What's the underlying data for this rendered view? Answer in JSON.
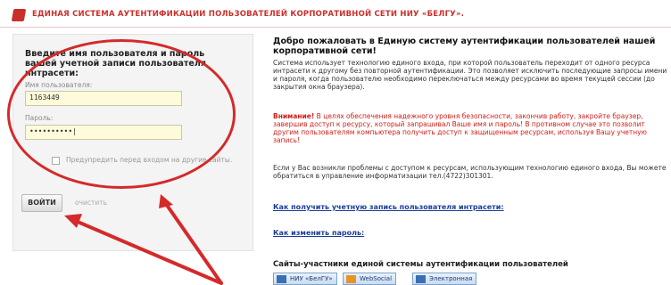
{
  "header": {
    "title": "ЕДИНАЯ СИСТЕМА АУТЕНТИФИКАЦИИ ПОЛЬЗОВАТЕЛЕЙ КОРПОРАТИВНОЙ СЕТИ НИУ «БЕЛГУ»."
  },
  "login": {
    "heading": "Введите имя пользователя и пароль вашей учетной записи пользователя интрасети:",
    "username_label": "Имя пользователя:",
    "username_value": "1163449",
    "password_label": "Пароль:",
    "password_value": "••••••••••|",
    "remember_label": "Предупредить перед входом на другие сайты.",
    "submit_label": "ВОЙТИ",
    "clear_label": "очистить"
  },
  "info": {
    "welcome": "Добро пожаловать в Единую систему аутентификации пользователей нашей корпоративной сети!",
    "description": "Система использует технологию единого входа, при которой пользователь переходит от одного ресурса интрасети к другому без повторной аутентификации. Это позволяет исключить последующие запросы имени и пароля, когда пользователю необходимо переключаться между ресурсами во время текущей сессии (до закрытия окна браузера).",
    "warning_label": "Внимание!",
    "warning_text": " В целях обеспечения надежного уровня безопасности, закончив работу, закройте браузер, завершив доступ к ресурсу, который запрашивал Ваше имя и пароль! В противном случае это позволит другим пользователям компьютера получить доступ к защищенным ресурсам, используя Вашу учетную запись!",
    "help_text": "Если у Вас возникли проблемы с доступом к ресурсам, использующим технологию единого входа, Вы можете обратиться в управление информатизации тел.(4722)301301.",
    "link_account": "Как получить учетную запись пользователя интрасети:",
    "link_password": "Как изменить пароль:",
    "sites_title": "Сайты-участники единой системы аутентификации пользователей",
    "sites": [
      "НИУ «БелГУ»",
      "WebSocial",
      "Электронная"
    ]
  },
  "colors": {
    "accent_red": "#d42a2a",
    "link_blue": "#1a3d9a",
    "input_bg": "#fdfbd9"
  }
}
